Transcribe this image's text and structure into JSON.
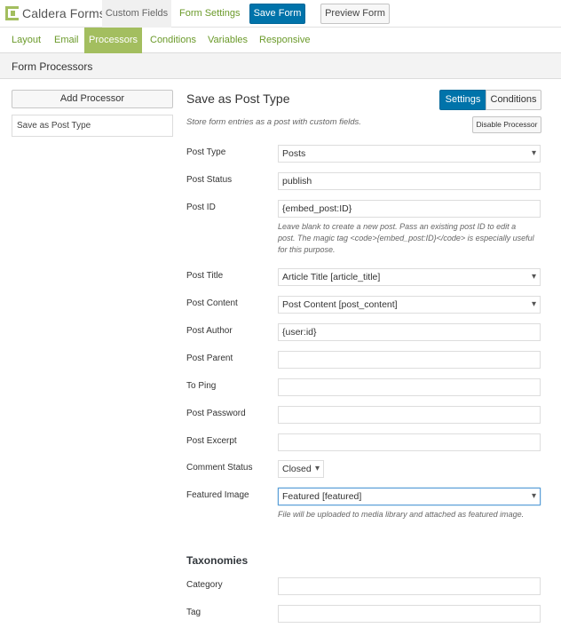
{
  "header": {
    "logo_text": "Caldera Forms",
    "custom_fields": "Custom Fields",
    "form_settings": "Form Settings",
    "save_form": "Save Form",
    "preview_form": "Preview Form"
  },
  "tabs": [
    "Layout",
    "Email",
    "Processors",
    "Conditions",
    "Variables",
    "Responsive"
  ],
  "active_tab": "Processors",
  "section_title": "Form Processors",
  "sidebar": {
    "add_processor": "Add Processor",
    "processors": [
      "Save as Post Type"
    ]
  },
  "processor": {
    "title": "Save as Post Type",
    "settings_btn": "Settings",
    "conditions_btn": "Conditions",
    "description": "Store form entries as a post with custom fields.",
    "disable_btn": "Disable Processor"
  },
  "fields": {
    "post_type": {
      "label": "Post Type",
      "value": "Posts"
    },
    "post_status": {
      "label": "Post Status",
      "value": "publish"
    },
    "post_id": {
      "label": "Post ID",
      "value": "{embed_post:ID}",
      "help": "Leave blank to create a new post. Pass an existing post ID to edit a post. The magic tag <code>{embed_post:ID}</code> is especially useful for this purpose."
    },
    "post_title": {
      "label": "Post Title",
      "value": "Article Title [article_title]"
    },
    "post_content": {
      "label": "Post Content",
      "value": "Post Content [post_content]"
    },
    "post_author": {
      "label": "Post Author",
      "value": "{user:id}"
    },
    "post_parent": {
      "label": "Post Parent",
      "value": ""
    },
    "to_ping": {
      "label": "To Ping",
      "value": ""
    },
    "post_password": {
      "label": "Post Password",
      "value": ""
    },
    "post_excerpt": {
      "label": "Post Excerpt",
      "value": ""
    },
    "comment_status": {
      "label": "Comment Status",
      "value": "Closed"
    },
    "featured_image": {
      "label": "Featured Image",
      "value": "Featured [featured]",
      "help": "File will be uploaded to media library and attached as featured image."
    }
  },
  "taxonomies": {
    "title": "Taxonomies",
    "category": {
      "label": "Category",
      "value": ""
    },
    "tag": {
      "label": "Tag",
      "value": ""
    }
  },
  "colors": {
    "accent_green": "#a3be5f",
    "primary_blue": "#0073aa"
  }
}
